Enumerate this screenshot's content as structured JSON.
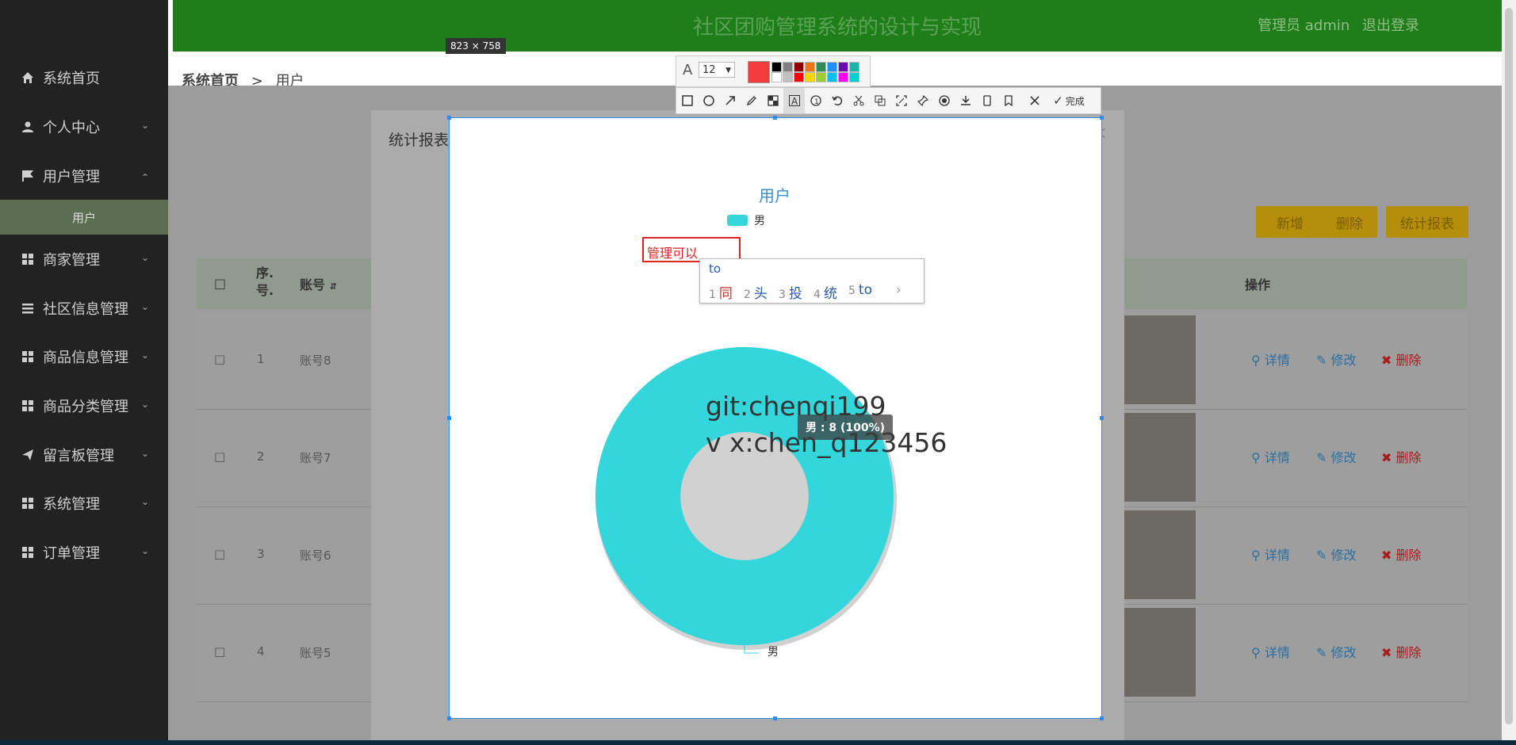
{
  "header": {
    "title": "社区团购管理系统的设计与实现",
    "admin": "管理员 admin",
    "logout": "退出登录"
  },
  "sidebar": {
    "items": [
      {
        "label": "系统首页",
        "icon": "home-icon"
      },
      {
        "label": "个人中心",
        "icon": "person-icon"
      },
      {
        "label": "用户管理",
        "icon": "flag-icon"
      },
      {
        "label": "商家管理",
        "icon": "grid-icon"
      },
      {
        "label": "社区信息管理",
        "icon": "list-icon"
      },
      {
        "label": "商品信息管理",
        "icon": "grid-icon"
      },
      {
        "label": "商品分类管理",
        "icon": "grid-icon"
      },
      {
        "label": "留言板管理",
        "icon": "send-icon"
      },
      {
        "label": "系统管理",
        "icon": "grid-icon"
      },
      {
        "label": "订单管理",
        "icon": "grid-icon"
      }
    ],
    "sub_item": "用户"
  },
  "breadcrumb": {
    "home": "系统首页",
    "sep": ">",
    "current": "用户"
  },
  "toolbar": {
    "add": "新增",
    "delete": "删除",
    "report": "统计报表"
  },
  "table": {
    "headers": {
      "index": "序.",
      "index2": "号.",
      "account": "账号",
      "actions": "操作"
    },
    "rows": [
      {
        "index": "1",
        "account": "账号8"
      },
      {
        "index": "2",
        "account": "账号7"
      },
      {
        "index": "3",
        "account": "账号6"
      },
      {
        "index": "4",
        "account": "账号5"
      }
    ],
    "action_labels": {
      "detail": "详情",
      "edit": "修改",
      "remove": "删除"
    }
  },
  "modal": {
    "title": "统计报表"
  },
  "screenshot_tool": {
    "dimensions": "823 × 758",
    "font_size": "12",
    "active_color": "#f23b3b",
    "palette": [
      "#000000",
      "#808080",
      "#8b0000",
      "#e8741c",
      "#2e8b57",
      "#1e90ff",
      "#6a0dad",
      "#20b2aa",
      "#ffffff",
      "#c0c0c0",
      "#ff0000",
      "#ffd700",
      "#9acd32",
      "#00bfff",
      "#ff00ff",
      "#00ced1"
    ],
    "done_label": "完成"
  },
  "annotation": {
    "text_value": "管理可以",
    "ime_input": "to",
    "candidates": [
      {
        "n": "1",
        "text": "同"
      },
      {
        "n": "2",
        "text": "头"
      },
      {
        "n": "3",
        "text": "投"
      },
      {
        "n": "4",
        "text": "统"
      },
      {
        "n": "5",
        "text": "to"
      }
    ]
  },
  "watermark": {
    "line1": "git:chenqi199",
    "line2": "v x:chen_q123456"
  },
  "chart_data": {
    "type": "pie",
    "title": "用户",
    "legend": [
      "男"
    ],
    "slices": [
      {
        "name": "男",
        "value": 8,
        "percent": 100
      }
    ],
    "tooltip": "男 : 8 (100%)",
    "colors": [
      "#33d6db"
    ],
    "hole_ratio": 0.43
  }
}
